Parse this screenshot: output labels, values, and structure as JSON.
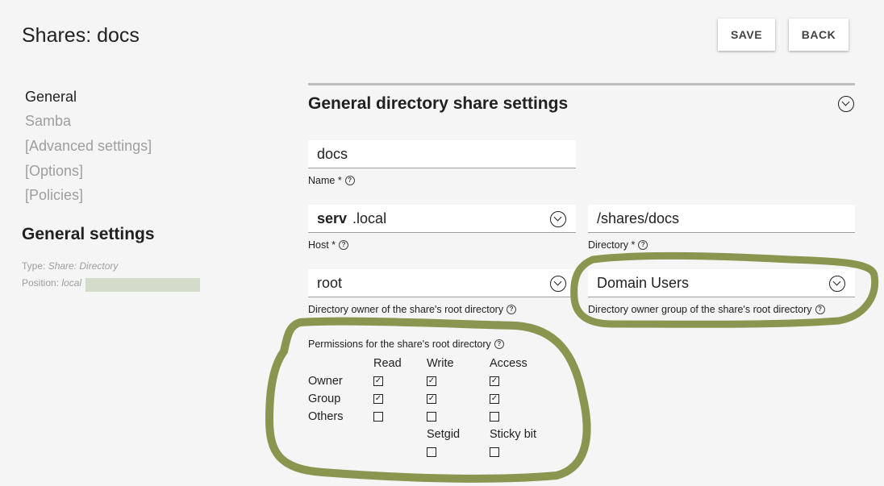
{
  "header": {
    "title": "Shares: docs",
    "save_label": "SAVE",
    "back_label": "BACK"
  },
  "sidebar": {
    "items": [
      {
        "label": "General",
        "active": true
      },
      {
        "label": "Samba",
        "active": false
      },
      {
        "label": "[Advanced settings]",
        "active": false
      },
      {
        "label": "[Options]",
        "active": false
      },
      {
        "label": "[Policies]",
        "active": false
      }
    ],
    "heading": "General settings",
    "type_label": "Type:",
    "type_value": "Share: Directory",
    "position_label": "Position:",
    "position_value": "local"
  },
  "section": {
    "title": "General directory share settings"
  },
  "form": {
    "name": {
      "value": "docs",
      "label": "Name *"
    },
    "host": {
      "value_bold": "serv",
      "value_suffix": ".local",
      "label": "Host *"
    },
    "directory": {
      "value": "/shares/docs",
      "label": "Directory *"
    },
    "owner": {
      "value": "root",
      "label": "Directory owner of the share's root directory"
    },
    "group": {
      "value": "Domain Users",
      "label": "Directory owner group of the share's root directory"
    }
  },
  "permissions": {
    "title": "Permissions for the share's root directory",
    "columns": [
      "Read",
      "Write",
      "Access"
    ],
    "rows": [
      {
        "label": "Owner",
        "values": [
          true,
          true,
          true
        ]
      },
      {
        "label": "Group",
        "values": [
          true,
          true,
          true
        ]
      },
      {
        "label": "Others",
        "values": [
          false,
          false,
          false
        ]
      }
    ],
    "extra": [
      {
        "label": "Setgid",
        "checked": false
      },
      {
        "label": "Sticky bit",
        "checked": false
      }
    ]
  },
  "colors": {
    "annotation": "#8a9650",
    "background": "#f5f5f5",
    "section_bar": "#bdbdbd"
  }
}
